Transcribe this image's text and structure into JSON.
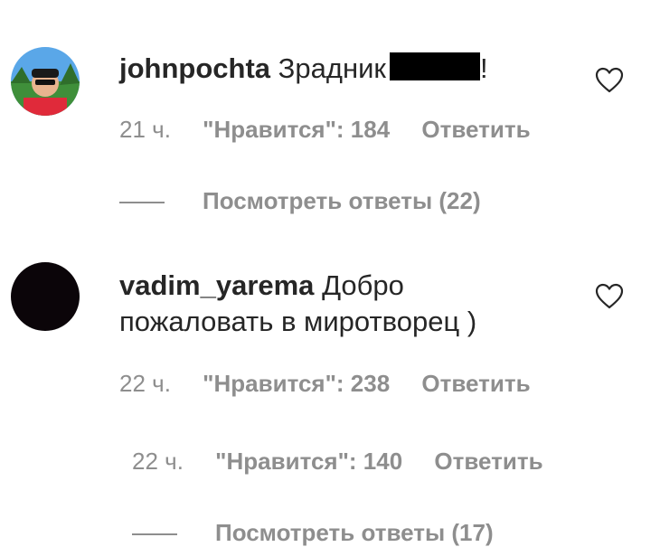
{
  "comments": [
    {
      "username": "johnpochta",
      "text_before": "Зрадник",
      "text_after": "!",
      "time": "21 ч.",
      "likes": "\"Нравится\": 184",
      "reply": "Ответить",
      "view_replies": "Посмотреть ответы (22)"
    },
    {
      "username": "vadim_yarema",
      "text_line1": "Добро",
      "text_line2": "пожаловать в миротворец )",
      "time": "22 ч.",
      "likes": "\"Нравится\": 238",
      "reply": "Ответить"
    }
  ],
  "nested_reply": {
    "time": "22 ч.",
    "likes": "\"Нравится\": 140",
    "reply": "Ответить",
    "view_replies": "Посмотреть ответы (17)"
  },
  "icons": {
    "like": "heart-outline-icon"
  },
  "colors": {
    "text": "#262626",
    "secondary": "#8e8e8e",
    "redaction": "#000000"
  }
}
